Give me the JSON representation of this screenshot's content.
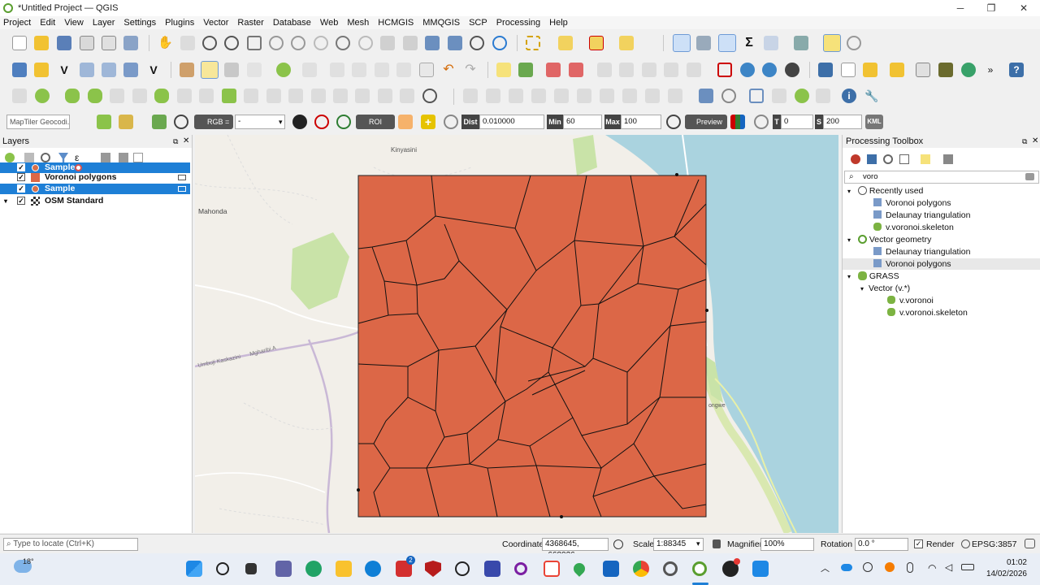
{
  "window": {
    "title": "*Untitled Project — QGIS"
  },
  "menu": [
    "Project",
    "Edit",
    "View",
    "Layer",
    "Settings",
    "Plugins",
    "Vector",
    "Raster",
    "Database",
    "Web",
    "Mesh",
    "HCMGIS",
    "MMQGIS",
    "SCP",
    "Processing",
    "Help"
  ],
  "scp_toolbar": {
    "geocoder_placeholder": "MapTiler Geocodi...",
    "rgb_label": "RGB =",
    "rgb_value": "-",
    "roi_label": "ROI",
    "dist_label": "Dist",
    "dist_value": "0.010000",
    "min_label": "Min",
    "min_value": "60",
    "max_label": "Max",
    "max_value": "100",
    "preview_label": "Preview",
    "t_label": "T",
    "t_value": "0",
    "s_label": "S",
    "s_value": "200",
    "kml_label": "KML"
  },
  "layers_panel": {
    "title": "Layers",
    "layers": [
      {
        "name": "Sample",
        "checked": true,
        "selected": true
      },
      {
        "name": "Voronoi polygons",
        "checked": true,
        "selected": false
      },
      {
        "name": "Sample",
        "checked": true,
        "selected": true
      },
      {
        "name": "OSM Standard",
        "checked": true,
        "selected": false
      }
    ]
  },
  "map_labels": {
    "town1": "Kinyasini",
    "town2": "Mahonda",
    "road1": "Umbuji Kaskazini",
    "road2": "Mgharibi A",
    "town3": "ongwe"
  },
  "toolbox": {
    "title": "Processing Toolbox",
    "search_value": "voro",
    "tree": [
      {
        "label": "Recently used",
        "level": 0,
        "icon": "clock-icon"
      },
      {
        "label": "Voronoi polygons",
        "level": 1,
        "icon": "algorithm-icon"
      },
      {
        "label": "Delaunay triangulation",
        "level": 1,
        "icon": "algorithm-icon"
      },
      {
        "label": "v.voronoi.skeleton",
        "level": 1,
        "icon": "grass-icon"
      },
      {
        "label": "Vector geometry",
        "level": 0,
        "icon": "qgis-icon"
      },
      {
        "label": "Delaunay triangulation",
        "level": 1,
        "icon": "algorithm-icon"
      },
      {
        "label": "Voronoi polygons",
        "level": 1,
        "icon": "algorithm-icon",
        "highlight": true
      },
      {
        "label": "GRASS",
        "level": 0,
        "icon": "grass-icon"
      },
      {
        "label": "Vector (v.*)",
        "level": 1,
        "icon": ""
      },
      {
        "label": "v.voronoi",
        "level": 2,
        "icon": "grass-icon"
      },
      {
        "label": "v.voronoi.skeleton",
        "level": 2,
        "icon": "grass-icon"
      }
    ]
  },
  "statusbar": {
    "locate_placeholder": "Type to locate (Ctrl+K)",
    "coordinate_label": "Coordinate",
    "coordinate_value": "4368645, -668026",
    "scale_label": "Scale",
    "scale_value": "1:88345",
    "magnifier_label": "Magnifier",
    "magnifier_value": "100%",
    "rotation_label": "Rotation",
    "rotation_value": "0.0 °",
    "render_label": "Render",
    "crs_label": "EPSG:3857"
  },
  "taskbar": {
    "weather_temp": "18°",
    "time": "01:02",
    "date": "14/02/2026",
    "badge_count": "2"
  },
  "colors": {
    "voronoi_fill": "#dc6747",
    "water": "#aad3df",
    "land": "#f2efe9",
    "selection": "#1e7fd6"
  }
}
